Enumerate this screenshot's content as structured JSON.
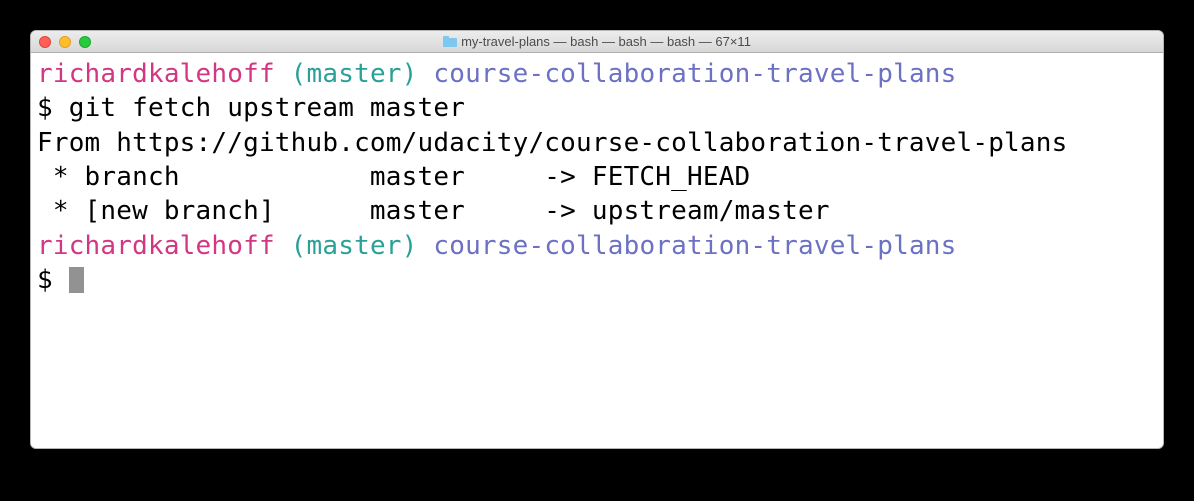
{
  "window": {
    "title": "my-travel-plans — bash — bash — bash — 67×11"
  },
  "prompt1": {
    "user": "richardkalehoff",
    "branch": "(master)",
    "dir": "course-collaboration-travel-plans",
    "symbol": "$ ",
    "command": "git fetch upstream master"
  },
  "output": {
    "line1": "From https://github.com/udacity/course-collaboration-travel-plans",
    "line2": " * branch            master     -> FETCH_HEAD",
    "line3": " * [new branch]      master     -> upstream/master"
  },
  "prompt2": {
    "user": "richardkalehoff",
    "branch": "(master)",
    "dir": "course-collaboration-travel-plans",
    "symbol": "$ "
  }
}
